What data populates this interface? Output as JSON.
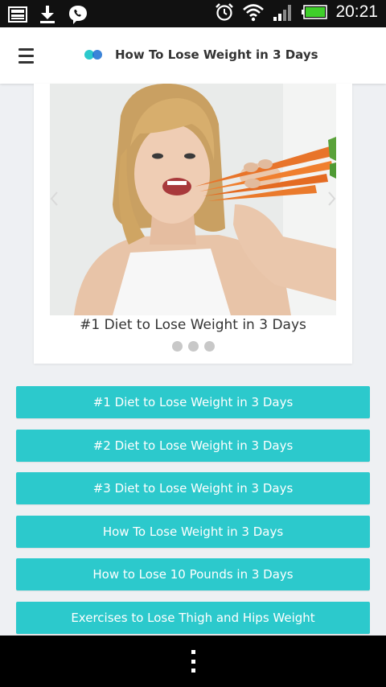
{
  "status_bar": {
    "time": "20:21",
    "icons_left": [
      "gallery-icon",
      "download-icon",
      "viber-icon"
    ],
    "icons_right": [
      "alarm-icon",
      "wifi-icon",
      "signal-icon",
      "battery-icon"
    ],
    "battery_color": "#3fcf2a"
  },
  "header": {
    "title": "How To Lose Weight in 3 Days",
    "menu_icon": "hamburger-icon",
    "logo_colors": [
      "#2cc9cc",
      "#1a6fd1"
    ]
  },
  "carousel": {
    "caption": "#1 Diet to Lose Weight in 3 Days",
    "slide_count": 3,
    "active_slide": 1,
    "image_description_icon": "woman-with-carrots-photo"
  },
  "buttons": [
    "#1 Diet to Lose Weight in 3 Days",
    "#2 Diet to Lose Weight in 3 Days",
    "#3 Diet to Lose Weight in 3 Days",
    "How To Lose Weight in 3 Days",
    "How to Lose 10 Pounds in 3 Days",
    "Exercises to Lose Thigh and Hips Weight"
  ],
  "colors": {
    "accent": "#2cc9cc",
    "background": "#eef0f3"
  },
  "nav_bar": {
    "overflow_icon": "overflow-menu-icon"
  }
}
